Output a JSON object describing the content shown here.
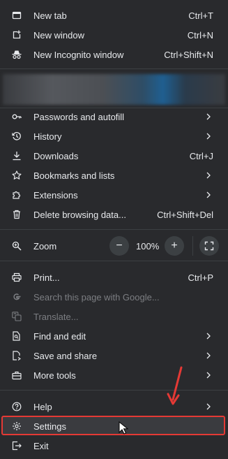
{
  "menu": {
    "new_tab": {
      "label": "New tab",
      "shortcut": "Ctrl+T"
    },
    "new_window": {
      "label": "New window",
      "shortcut": "Ctrl+N"
    },
    "incognito": {
      "label": "New Incognito window",
      "shortcut": "Ctrl+Shift+N"
    },
    "passwords": {
      "label": "Passwords and autofill"
    },
    "history": {
      "label": "History"
    },
    "downloads": {
      "label": "Downloads",
      "shortcut": "Ctrl+J"
    },
    "bookmarks": {
      "label": "Bookmarks and lists"
    },
    "extensions": {
      "label": "Extensions"
    },
    "delete_data": {
      "label": "Delete browsing data...",
      "shortcut": "Ctrl+Shift+Del"
    },
    "zoom": {
      "label": "Zoom",
      "value": "100%",
      "minus": "−",
      "plus": "+"
    },
    "print": {
      "label": "Print...",
      "shortcut": "Ctrl+P"
    },
    "search_google": {
      "label": "Search this page with Google..."
    },
    "translate": {
      "label": "Translate..."
    },
    "find_edit": {
      "label": "Find and edit"
    },
    "save_share": {
      "label": "Save and share"
    },
    "more_tools": {
      "label": "More tools"
    },
    "help": {
      "label": "Help"
    },
    "settings": {
      "label": "Settings"
    },
    "exit": {
      "label": "Exit"
    }
  },
  "colors": {
    "background": "#292a2d",
    "text": "#e8eaed",
    "disabled": "#7c7e82",
    "highlight_border": "#e53935"
  },
  "icons": [
    "new-tab-icon",
    "new-window-icon",
    "incognito-icon",
    "key-icon",
    "history-icon",
    "download-icon",
    "star-icon",
    "puzzle-icon",
    "trash-icon",
    "zoom-icon",
    "print-icon",
    "google-icon",
    "translate-icon",
    "find-icon",
    "share-icon",
    "toolbox-icon",
    "help-icon",
    "gear-icon",
    "exit-icon"
  ]
}
